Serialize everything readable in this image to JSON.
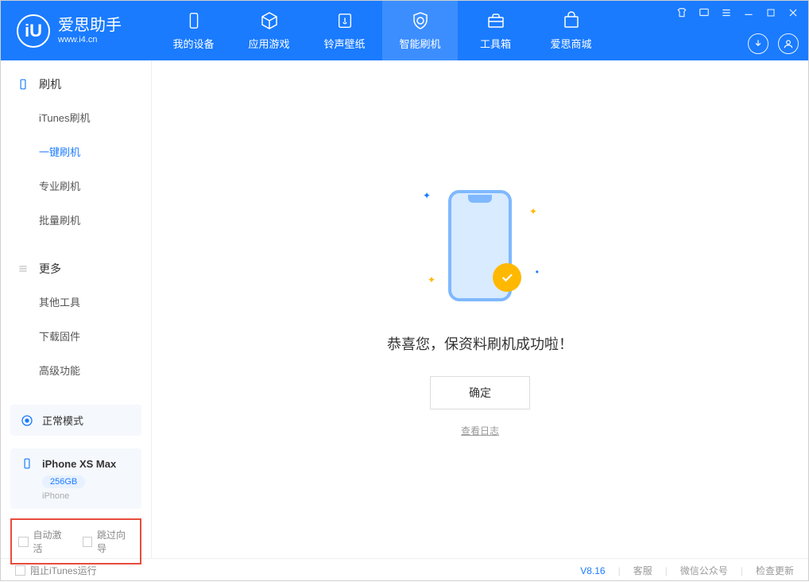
{
  "app": {
    "name": "爱思助手",
    "url": "www.i4.cn"
  },
  "tabs": [
    {
      "label": "我的设备"
    },
    {
      "label": "应用游戏"
    },
    {
      "label": "铃声壁纸"
    },
    {
      "label": "智能刷机"
    },
    {
      "label": "工具箱"
    },
    {
      "label": "爱思商城"
    }
  ],
  "sidebar": {
    "section1": {
      "title": "刷机",
      "items": [
        {
          "label": "iTunes刷机"
        },
        {
          "label": "一键刷机"
        },
        {
          "label": "专业刷机"
        },
        {
          "label": "批量刷机"
        }
      ]
    },
    "section2": {
      "title": "更多",
      "items": [
        {
          "label": "其他工具"
        },
        {
          "label": "下载固件"
        },
        {
          "label": "高级功能"
        }
      ]
    },
    "mode": "正常模式",
    "device": {
      "name": "iPhone XS Max",
      "capacity": "256GB",
      "type": "iPhone"
    },
    "options": {
      "auto_activate": "自动激活",
      "skip_guide": "跳过向导"
    }
  },
  "main": {
    "success_text": "恭喜您，保资料刷机成功啦！",
    "confirm": "确定",
    "log_link": "查看日志"
  },
  "footer": {
    "block_itunes": "阻止iTunes运行",
    "version": "V8.16",
    "links": {
      "support": "客服",
      "wechat": "微信公众号",
      "update": "检查更新"
    }
  }
}
